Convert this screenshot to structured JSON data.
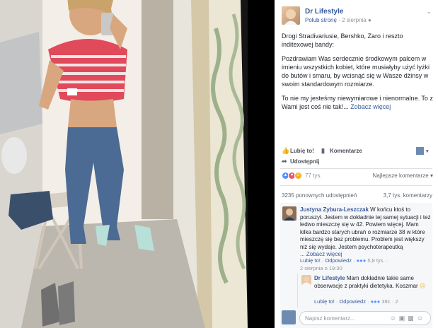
{
  "page": {
    "name": "Dr Lifestyle",
    "follow": "Polub stronę",
    "date": "2 sierpnia",
    "dot": "·"
  },
  "post": {
    "p1": "Drogi Stradivariusie, Bershko, Zaro i reszto inditexowej bandy:",
    "p2": "Pozdrawiam Was serdecznie środkowym palcem w imieniu wszystkich kobiet, które musiałyby użyć łyżki do butów i smaru, by wcisnąć się w Wasze dżinsy w swoim standardowym rozmiarze.",
    "p3": "To nie my jesteśmy niewymiarowe i nienormalne. To z Wami jest coś nie tak!...",
    "see_more": "Zobacz więcej"
  },
  "actions": {
    "like": "Lubię to!",
    "comment": "Komentarze",
    "share": "Udostępnij"
  },
  "reactions": {
    "count": "77 tys.",
    "sort": "Najlepsze komentarze"
  },
  "shares": {
    "shares_text": "3235 ponownych udostępnień",
    "comments_text": "3,7 tys. komentarzy"
  },
  "comments": [
    {
      "author": "Justyna Zybura-Leszczak",
      "text": "W końcu ktoś to poruszył. Jestem w dokładnie tej samej sytuacji i też ledwo mieszczę się w 42. Powiem więcej. Mam kilka bardzo starych ubrań o rozmiarze 38 w które mieszczę się bez problemu. Problem jest większy niż się wydaje. Jestem psychoterapeutką",
      "more": "... Zobacz więcej",
      "like": "Lubię to!",
      "reply": "Odpowiedz",
      "reacts": "5,8 tys.",
      "time": "2 sierpnia o 19:30"
    },
    {
      "author": "Dr Lifestyle",
      "text": "Mam dokładnie takie same obserwacje z praktyki dietetyka. Koszmar",
      "like": "Lubię to!",
      "reply": "Odpowiedz",
      "reacts": "391",
      "time": "2"
    }
  ],
  "input": {
    "placeholder": "Napisz komentarz..."
  },
  "colors": {
    "link": "#365899",
    "like_blue": "#5890ff",
    "love_red": "#f25268",
    "haha_yellow": "#f7b125"
  }
}
